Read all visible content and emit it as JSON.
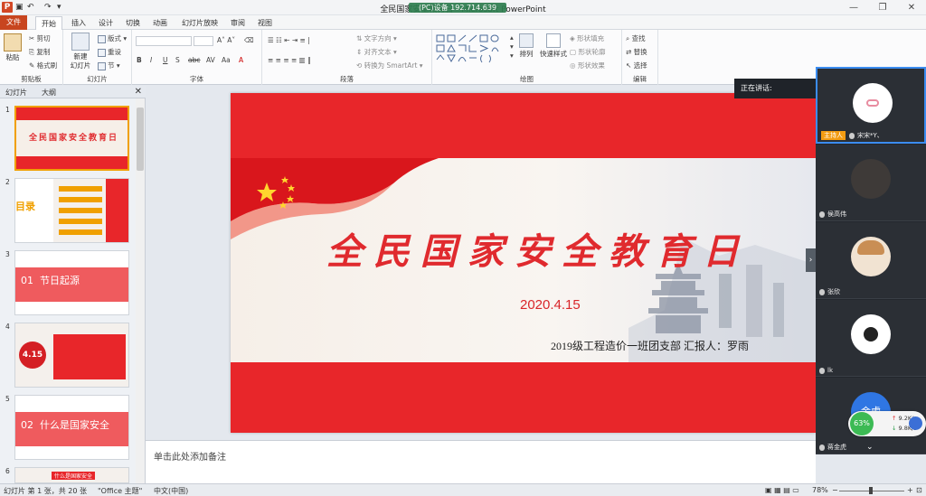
{
  "window": {
    "title": "全民国家安全教育日 - Microsoft PowerPoint",
    "rec_overlay": "(PC)设备 192.714.639"
  },
  "tabs": {
    "file": "文件",
    "home": "开始",
    "insert": "插入",
    "design": "设计",
    "transitions": "切换",
    "animations": "动画",
    "slideshow": "幻灯片放映",
    "review": "审阅",
    "view": "视图"
  },
  "ribbon": {
    "clipboard": {
      "label": "剪贴板",
      "paste": "粘贴",
      "cut": "剪切",
      "copy": "复制",
      "format_painter": "格式刷"
    },
    "slides": {
      "label": "幻灯片",
      "new_slide": "新建\n幻灯片",
      "layout": "版式",
      "reset": "重设",
      "section": "节"
    },
    "font": {
      "label": "字体",
      "font_name": "",
      "font_size": ""
    },
    "paragraph": {
      "label": "段落",
      "text_direction": "文字方向",
      "align_text": "对齐文本",
      "convert_smartart": "转换为 SmartArt"
    },
    "drawing": {
      "label": "绘图",
      "arrange": "排列",
      "quick_styles": "快速样式",
      "shape_fill": "形状填充",
      "shape_outline": "形状轮廓",
      "shape_effects": "形状效果"
    },
    "editing": {
      "label": "编辑",
      "find": "查找",
      "replace": "替换",
      "select": "选择"
    }
  },
  "panel": {
    "tab_slides": "幻灯片",
    "tab_outline": "大纲",
    "thumbs": [
      {
        "num": "1",
        "text": "全民国家安全教育日"
      },
      {
        "num": "2",
        "text": "目录"
      },
      {
        "num": "3",
        "text": "01  节日起源"
      },
      {
        "num": "4",
        "text": "4.15"
      },
      {
        "num": "5",
        "text": "02  什么是国家安全"
      },
      {
        "num": "6",
        "text": "什么是国家安全"
      }
    ]
  },
  "slide": {
    "title": "全民国家安全教育日",
    "date": "2020.4.15",
    "subtitle": "2019级工程造价一班团支部    汇报人：罗雨"
  },
  "notes": {
    "placeholder": "单击此处添加备注"
  },
  "status": {
    "slide_info": "幻灯片 第 1 张，共 20 张",
    "theme": "\"Office 主题\"",
    "language": "中文(中国)",
    "zoom": "78%"
  },
  "meeting": {
    "speaking_label": "正在讲话:",
    "host_badge": "主持人",
    "participants": [
      {
        "name": "宋宋*Y、",
        "host": true
      },
      {
        "name": "侯高伟",
        "host": false
      },
      {
        "name": "张欣",
        "host": false
      },
      {
        "name": "lk",
        "host": false
      },
      {
        "name": "蒋金虎",
        "host": false
      }
    ],
    "avatar_5_text": "金虎"
  },
  "network": {
    "percent": "63%",
    "up": "9.2K/s",
    "down": "9.8K/s"
  },
  "colors": {
    "accent": "#c8451f",
    "slide_red": "#e8262a",
    "meeting_bg": "#23272d"
  }
}
